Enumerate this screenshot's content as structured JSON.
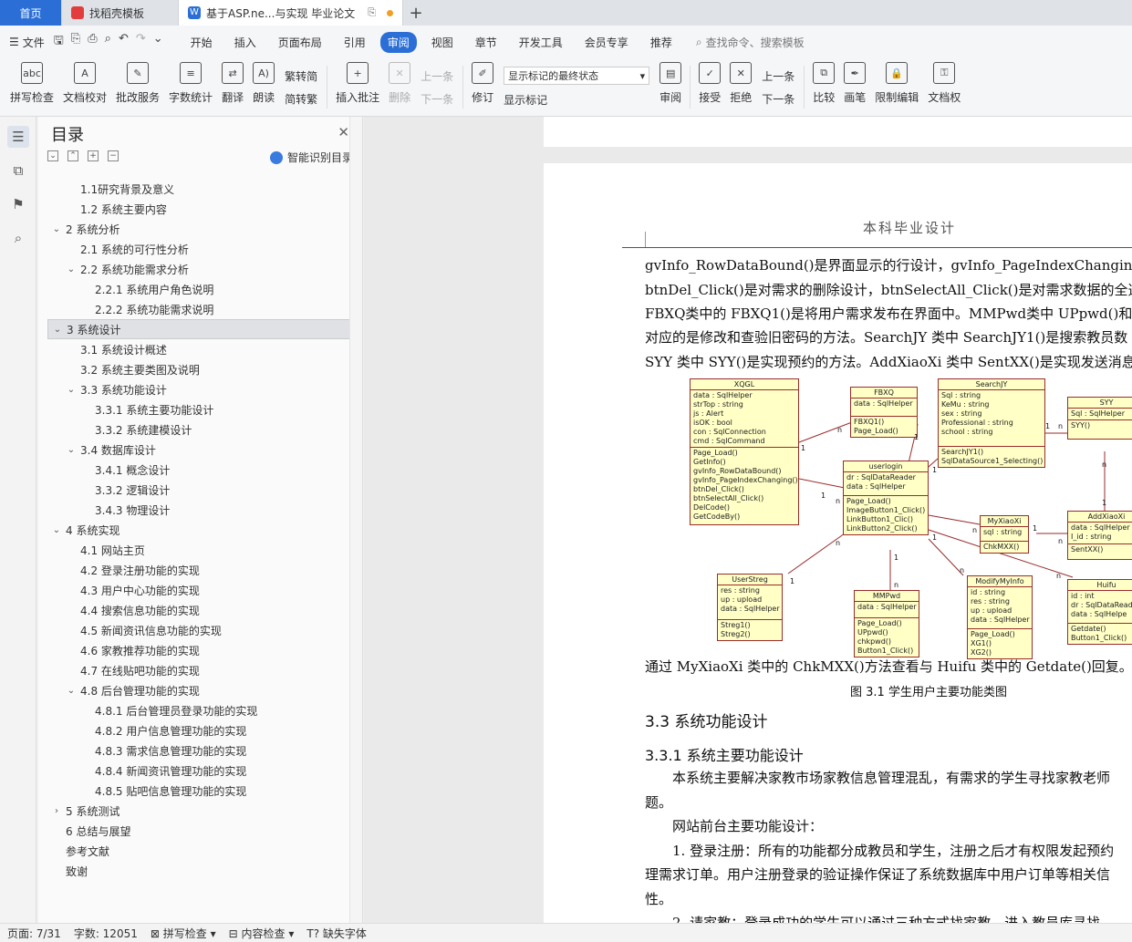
{
  "tabs": [
    {
      "label": "首页"
    },
    {
      "label": "找稻壳模板"
    },
    {
      "label": "基于ASP.ne...与实现 毕业论文"
    }
  ],
  "menubar": {
    "file_label": "文件",
    "items": [
      "开始",
      "插入",
      "页面布局",
      "引用",
      "审阅",
      "视图",
      "章节",
      "开发工具",
      "会员专享",
      "推荐"
    ],
    "active": "审阅",
    "search_placeholder": "查找命令、搜索模板"
  },
  "ribbon": {
    "spell_check": "拼写检查",
    "doc_proof": "文档校对",
    "batch_service": "批改服务",
    "word_count": "字数统计",
    "translate": "翻译",
    "read_aloud": "朗读",
    "to_traditional": "繁转简",
    "to_simplified": "简转繁",
    "insert_comment": "插入批注",
    "delete": "删除",
    "prev_comment": "上一条",
    "next_comment": "下一条",
    "revise": "修订",
    "markup_select": "显示标记的最终状态",
    "show_markup": "显示标记",
    "review": "审阅",
    "accept": "接受",
    "reject": "拒绝",
    "prev_change": "上一条",
    "next_change": "下一条",
    "compare": "比较",
    "pen": "画笔",
    "restrict_edit": "限制编辑",
    "doc_permission": "文档权"
  },
  "toc": {
    "title": "目录",
    "smart_label": "智能识别目录",
    "items": [
      {
        "label": "1.1研究背景及意义",
        "level": 2,
        "caret": ""
      },
      {
        "label": "1.2 系统主要内容",
        "level": 2,
        "caret": ""
      },
      {
        "label": "2 系统分析",
        "level": 1,
        "caret": "v"
      },
      {
        "label": "2.1 系统的可行性分析",
        "level": 2,
        "caret": ""
      },
      {
        "label": "2.2 系统功能需求分析",
        "level": 2,
        "caret": "v"
      },
      {
        "label": "2.2.1 系统用户角色说明",
        "level": 3,
        "caret": ""
      },
      {
        "label": "2.2.2 系统功能需求说明",
        "level": 3,
        "caret": ""
      },
      {
        "label": "3 系统设计",
        "level": 1,
        "caret": "v",
        "selected": true
      },
      {
        "label": "3.1 系统设计概述",
        "level": 2,
        "caret": ""
      },
      {
        "label": "3.2  系统主要类图及说明",
        "level": 2,
        "caret": ""
      },
      {
        "label": "3.3 系统功能设计",
        "level": 2,
        "caret": "v"
      },
      {
        "label": "3.3.1  系统主要功能设计",
        "level": 3,
        "caret": ""
      },
      {
        "label": "3.3.2  系统建模设计",
        "level": 3,
        "caret": ""
      },
      {
        "label": "3.4 数据库设计",
        "level": 2,
        "caret": "v"
      },
      {
        "label": "3.4.1  概念设计",
        "level": 3,
        "caret": ""
      },
      {
        "label": "3.3.2  逻辑设计",
        "level": 3,
        "caret": ""
      },
      {
        "label": "3.4.3  物理设计",
        "level": 3,
        "caret": ""
      },
      {
        "label": "4 系统实现",
        "level": 1,
        "caret": "v"
      },
      {
        "label": "4.1 网站主页",
        "level": 2,
        "caret": ""
      },
      {
        "label": "4.2  登录注册功能的实现",
        "level": 2,
        "caret": ""
      },
      {
        "label": "4.3 用户中心功能的实现",
        "level": 2,
        "caret": ""
      },
      {
        "label": "4.4 搜索信息功能的实现",
        "level": 2,
        "caret": ""
      },
      {
        "label": "4.5 新闻资讯信息功能的实现",
        "level": 2,
        "caret": ""
      },
      {
        "label": "4.6 家教推荐功能的实现",
        "level": 2,
        "caret": ""
      },
      {
        "label": "4.7 在线贴吧功能的实现",
        "level": 2,
        "caret": ""
      },
      {
        "label": "4.8 后台管理功能的实现",
        "level": 2,
        "caret": "v"
      },
      {
        "label": "4.8.1  后台管理员登录功能的实现",
        "level": 3,
        "caret": ""
      },
      {
        "label": "4.8.2  用户信息管理功能的实现",
        "level": 3,
        "caret": ""
      },
      {
        "label": "4.8.3  需求信息管理功能的实现",
        "level": 3,
        "caret": ""
      },
      {
        "label": "4.8.4  新闻资讯管理功能的实现",
        "level": 3,
        "caret": ""
      },
      {
        "label": "4.8.5  贴吧信息管理功能的实现",
        "level": 3,
        "caret": ""
      },
      {
        "label": "5 系统测试",
        "level": 1,
        "caret": ">"
      },
      {
        "label": "6 总结与展望",
        "level": 1,
        "caret": ""
      },
      {
        "label": "参考文献",
        "level": 1,
        "caret": ""
      },
      {
        "label": "致谢",
        "level": 1,
        "caret": ""
      }
    ]
  },
  "document": {
    "header": "本科毕业设计",
    "lines": [
      "gvInfo_RowDataBound()是界面显示的行设计，gvInfo_PageIndexChanging()是翻",
      "btnDel_Click()是对需求的删除设计，btnSelectAll_Click()是对需求数据的全选",
      "FBXQ类中的 FBXQ1()是将用户需求发布在界面中。MMPwd类中 UPpwd()和",
      "对应的是修改和查验旧密码的方法。SearchJY 类中 SearchJY1()是搜索教员数",
      "SYY 类中 SYY()是实现预约的方法。AddXiaoXi 类中 SentXX()是实现发送消息"
    ],
    "after_figure": "通过 MyXiaoXi 类中的 ChkMXX()方法查看与 Huifu 类中的 Getdate()回复。",
    "caption": "图 3.1  学生用户主要功能类图",
    "h2": "3.3 系统功能设计",
    "h3": "3.3.1  系统主要功能设计",
    "para1": "本系统主要解决家教市场家教信息管理混乱，有需求的学生寻找家教老师",
    "para1b": "题。",
    "para2": "网站前台主要功能设计：",
    "para3": "1.  登录注册：所有的功能都分成教员和学生，注册之后才有权限发起预约",
    "para3b": "理需求订单。用户注册登录的验证操作保证了系统数据库中用户订单等相关信",
    "para3c": "性。",
    "para4": "2.  请家教：登录成功的学生可以通过三种方式找家教，进入教员库寻找"
  },
  "uml": {
    "classes": [
      {
        "name": "XQGL",
        "attrs": [
          "data : SqlHelper",
          "strTop : string",
          "js : Alert",
          "isOK : bool",
          "con : SqlConnection",
          "cmd : SqlCommand"
        ],
        "ops": [
          "Page_Load()",
          "GetInfo()",
          "gvInfo_RowDataBound()",
          "gvInfo_PageIndexChanging()",
          "btnDel_Click()",
          "btnSelectAll_Click()",
          "DelCode()",
          "GetCodeBy()"
        ]
      },
      {
        "name": "FBXQ",
        "attrs": [
          "data : SqlHelper"
        ],
        "ops": [
          "FBXQ1()",
          "Page_Load()"
        ]
      },
      {
        "name": "SearchJY",
        "attrs": [
          "Sql : string",
          "KeMu : string",
          "sex : string",
          "Professional : string",
          "school : string"
        ],
        "ops": [
          "SearchJY1()",
          "SqlDataSource1_Selecting()"
        ]
      },
      {
        "name": "SYY",
        "attrs": [
          "Sql : SqlHelper"
        ],
        "ops": [
          "SYY()"
        ]
      },
      {
        "name": "userlogin",
        "attrs": [
          "dr : SqlDataReader",
          "data : SqlHelper"
        ],
        "ops": [
          "Page_Load()",
          "ImageButton1_Click()",
          "LinkButton1_Clic()",
          "LinkButton2_Click()"
        ]
      },
      {
        "name": "MyXiaoXi",
        "attrs": [
          "sql : string"
        ],
        "ops": [
          "ChkMXX()"
        ]
      },
      {
        "name": "AddXiaoXi",
        "attrs": [
          "data : SqlHelper",
          "I_id : string"
        ],
        "ops": [
          "SentXX()"
        ]
      },
      {
        "name": "UserStreg",
        "attrs": [
          "res : string",
          "up : upload",
          "data : SqlHelper"
        ],
        "ops": [
          "Streg1()",
          "Streg2()"
        ]
      },
      {
        "name": "MMPwd",
        "attrs": [
          "data : SqlHelper"
        ],
        "ops": [
          "Page_Load()",
          "UPpwd()",
          "chkpwd()",
          "Button1_Click()"
        ]
      },
      {
        "name": "ModifyMyInfo",
        "attrs": [
          "id : string",
          "res : string",
          "up : upload",
          "data : SqlHelper"
        ],
        "ops": [
          "Page_Load()",
          "XG1()",
          "XG2()"
        ]
      },
      {
        "name": "Huifu",
        "attrs": [
          "id : int",
          "dr : SqlDataRead",
          "data : SqlHelpe"
        ],
        "ops": [
          "Getdate()",
          "Button1_Click()"
        ]
      }
    ],
    "multiplicities": [
      "1",
      "n",
      "1",
      "n",
      "1",
      "1",
      "n",
      "1",
      "n",
      "1",
      "n",
      "1",
      "n",
      "1",
      "n",
      "1",
      "n",
      "1",
      "n",
      "n"
    ]
  },
  "status": {
    "page": "页面: 7/31",
    "words": "字数: 12051",
    "spell": "拼写检查",
    "content_check": "内容检查",
    "missing_font": "缺失字体"
  }
}
